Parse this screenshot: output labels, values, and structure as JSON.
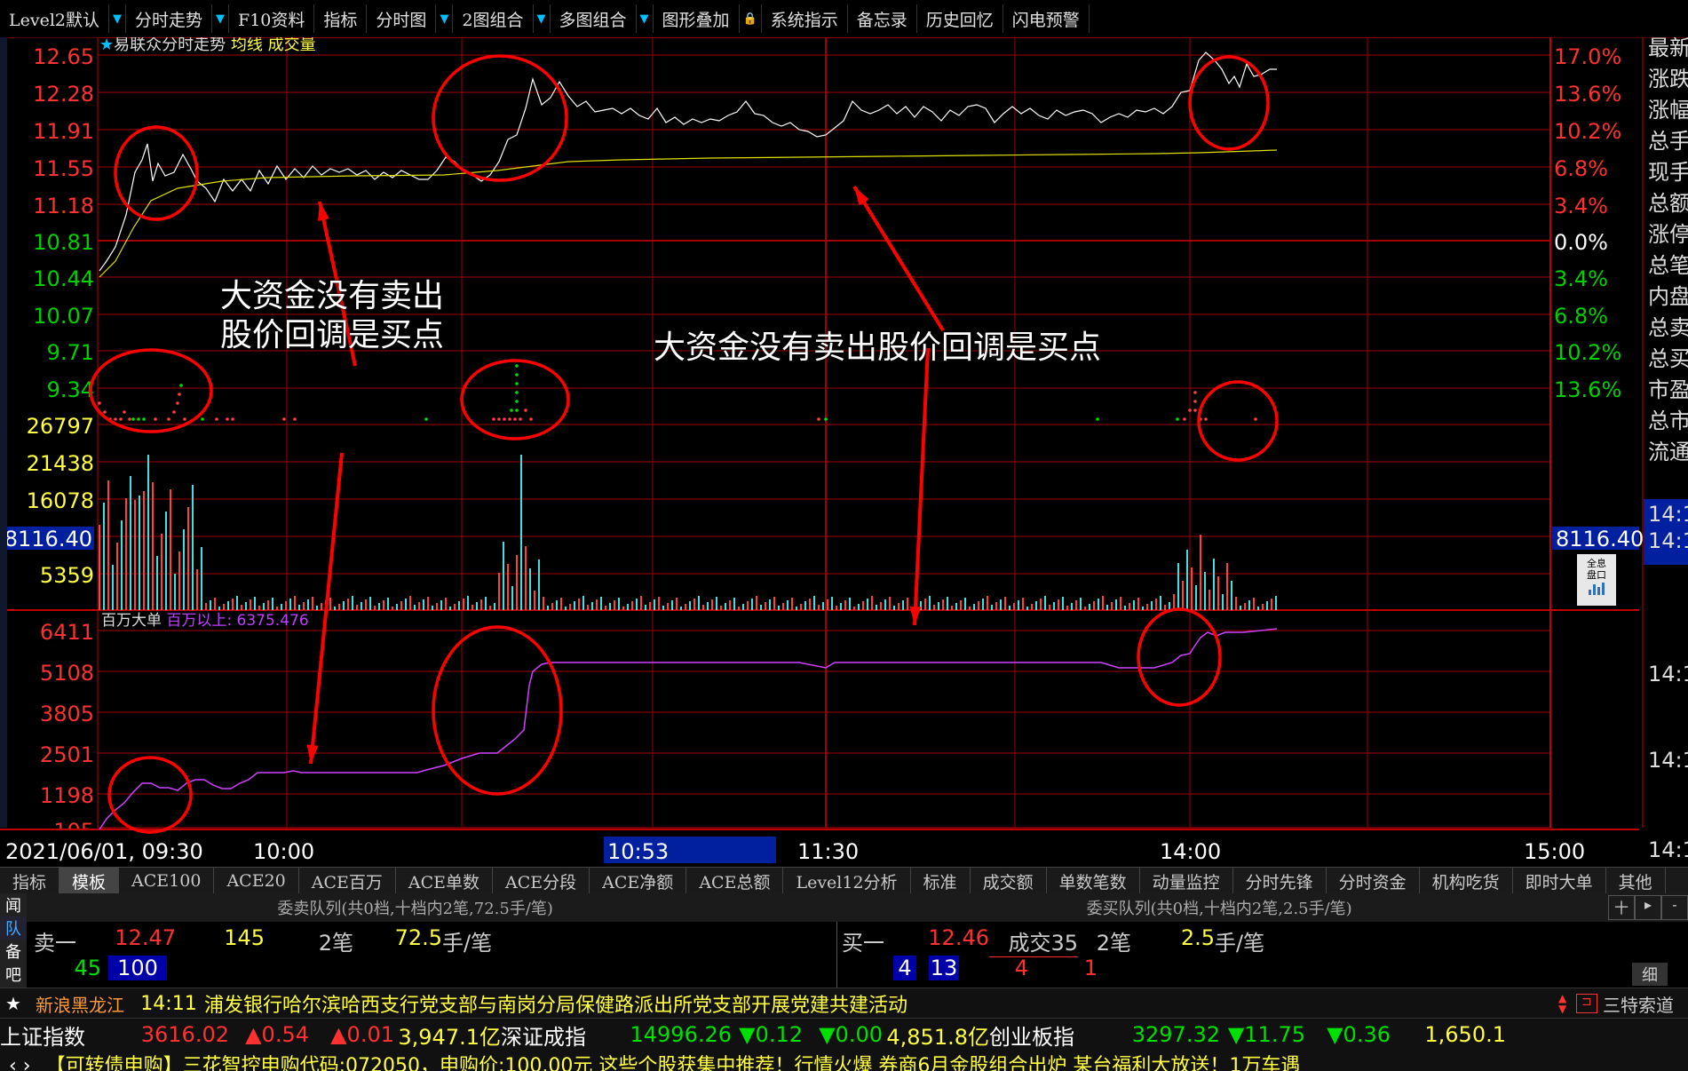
{
  "toolbar": {
    "items": [
      {
        "label": "Level2默认",
        "arrow": true
      },
      {
        "label": "分时走势",
        "arrow": true
      },
      {
        "label": "F10资料",
        "arrow": false
      },
      {
        "label": "指标",
        "arrow": false
      },
      {
        "label": "分时图",
        "arrow": true
      },
      {
        "label": "2图组合",
        "arrow": true
      },
      {
        "label": "多图组合",
        "arrow": true
      },
      {
        "label": "图形叠加",
        "arrow": false
      },
      {
        "label": "系统指示",
        "arrow": false
      },
      {
        "label": "备忘录",
        "arrow": false
      },
      {
        "label": "历史回忆",
        "arrow": false
      },
      {
        "label": "闪电预警",
        "arrow": false
      }
    ]
  },
  "chart_header": {
    "stock": "易联众分时走势",
    "avg": "均线",
    "vol": "成交量"
  },
  "price_axis": [
    "12.65",
    "12.28",
    "11.91",
    "11.55",
    "11.18",
    "10.81",
    "10.44",
    "10.07",
    "9.71",
    "9.34"
  ],
  "pct_axis": [
    "17.0%",
    "13.6%",
    "10.2%",
    "6.8%",
    "3.4%",
    "0.0%",
    "3.4%",
    "6.8%",
    "10.2%",
    "13.6%"
  ],
  "vol_axis": [
    "26797",
    "21438",
    "16078",
    "8116.40",
    "5359"
  ],
  "vol_marker_right": "8116.40",
  "sub_header": {
    "name": "百万大单",
    "value_label": "百万以上: 6375.476"
  },
  "sub_axis": [
    "6411",
    "5108",
    "3805",
    "2501",
    "1198",
    "105"
  ],
  "time_axis": {
    "start": "2021/06/01, 09:30",
    "t1": "10:00",
    "cursor": "10:53",
    "t2": "11:30",
    "t3": "14:00",
    "t4": "15:00"
  },
  "right_panel": [
    "最新",
    "涨跌",
    "涨幅",
    "总手",
    "现手",
    "总额",
    "涨停",
    "总笔",
    "内盘",
    "总卖",
    "总买",
    "市盈",
    "总市",
    "流通"
  ],
  "right_times": [
    "14:1",
    "14:1",
    "14:1",
    "14:1",
    "14:1",
    "14:1"
  ],
  "full_button": "全息盘口",
  "annotations": {
    "left": [
      "大资金没有卖出",
      "股价回调是买点"
    ],
    "center": "大资金没有卖出股价回调是买点"
  },
  "tabs": [
    "指标",
    "模板",
    "ACE100",
    "ACE20",
    "ACE百万",
    "ACE单数",
    "ACE分段",
    "ACE净额",
    "ACE总额",
    "Level12分析",
    "标准",
    "成交额",
    "单数笔数",
    "动量监控",
    "分时先锋",
    "分时资金",
    "机构吃货",
    "即时大单",
    "其他"
  ],
  "queue": {
    "sell_title": "委卖队列(共0档,十档内2笔,72.5手/笔)",
    "buy_title": "委买队列(共0档,十档内2笔,2.5手/笔)",
    "side_labels": [
      "闻",
      "队",
      "备",
      "吧"
    ],
    "sell": {
      "label": "卖一",
      "price": "12.47",
      "vol": "145",
      "count": "2笔",
      "per": "72.5",
      "unit": "手/笔",
      "q1": "45",
      "q2": "100"
    },
    "buy": {
      "label": "买一",
      "price": "12.46",
      "deal": "成交35",
      "count": "2笔",
      "per": "2.5",
      "unit": "手/笔",
      "q": [
        "4",
        "13",
        "4",
        "1"
      ]
    },
    "ctrl": [
      "十",
      "▸",
      "-"
    ],
    "detail": "细"
  },
  "news": {
    "source": "新浪黑龙江",
    "time": "14:11",
    "text": "浦发银行哈尔滨哈西支行党支部与南岗分局保健路派出所党支部开展党建共建活动",
    "right": "三特索道"
  },
  "indices": [
    {
      "name": "上证指数",
      "value": "3616.02",
      "chg": "▲0.54",
      "pct": "▲0.01",
      "amt": "3,947.1亿"
    },
    {
      "name": "深证成指",
      "value": "14996.26",
      "chg": "▼0.12",
      "pct": "▼0.00",
      "amt": "4,851.8亿"
    },
    {
      "name": "创业板指",
      "value": "3297.32",
      "chg": "▼11.75",
      "pct": "▼0.36",
      "amt": "1,650.1"
    }
  ],
  "ticker": "【可转债申购】三花智控申购代码:072050，申购价:100.00元    这些个股获集中推荐！行情火爆  券商6月金股组合出炉      某台福利大放送！1万车遇"
}
